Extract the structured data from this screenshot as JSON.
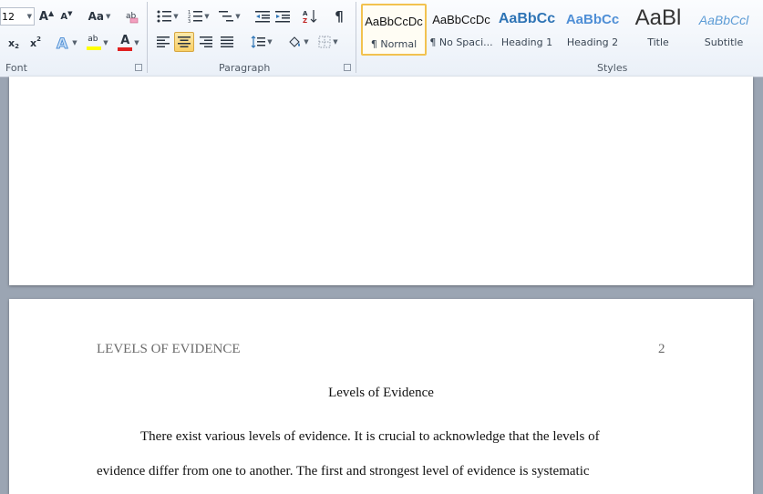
{
  "ribbon": {
    "font_group_label": "Font",
    "paragraph_group_label": "Paragraph",
    "styles_group_label": "Styles",
    "font_size": "12",
    "change_case_label": "Aa",
    "text_highlight_label": "ab",
    "font_color_label": "A",
    "styles": [
      {
        "sample": "AaBbCcDc",
        "name": "¶ Normal"
      },
      {
        "sample": "AaBbCcDc",
        "name": "¶ No Spaci..."
      },
      {
        "sample": "AaBbCc",
        "name": "Heading 1"
      },
      {
        "sample": "AaBbCc",
        "name": "Heading 2"
      },
      {
        "sample": "AaBl",
        "name": "Title"
      },
      {
        "sample": "AaBbCcl",
        "name": "Subtitle"
      }
    ],
    "colors": {
      "accent_selected": "#f2c24f",
      "heading": "#2e74b5",
      "font_color_bar": "#e02020",
      "highlight_bar": "#ffff00"
    }
  },
  "document": {
    "header_text": "LEVELS OF EVIDENCE",
    "page_number": "2",
    "title": "Levels of Evidence",
    "paragraph_line1": "There exist various levels of evidence. It is crucial to acknowledge that the levels of",
    "paragraph_line2": "evidence differ from one to another. The first and strongest level of evidence is systematic"
  }
}
